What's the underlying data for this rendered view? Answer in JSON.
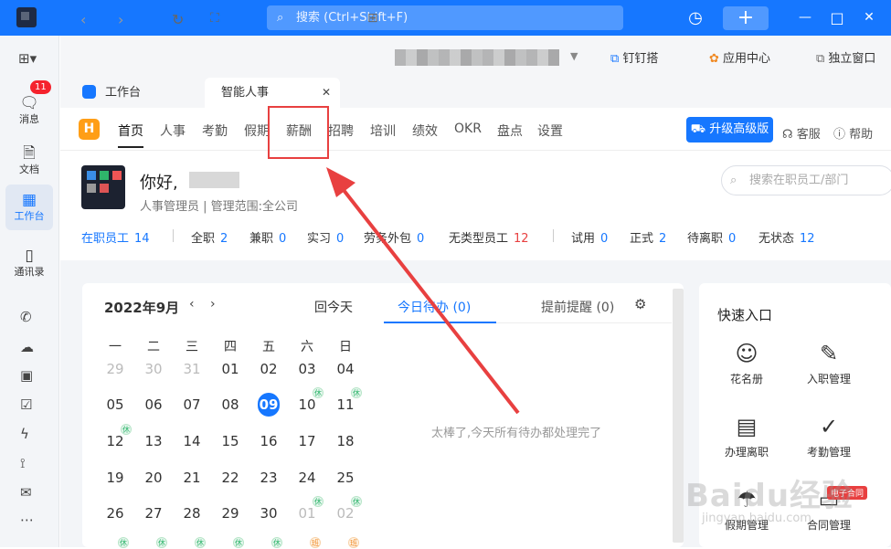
{
  "titlebar": {
    "search_placeholder": "搜索 (Ctrl+Shift+F)",
    "search_icon": "search-icon",
    "history_icon": "history-icon",
    "plus_label": "+",
    "min": "—",
    "max": "□",
    "close": "✕",
    "accent": "#1677ff"
  },
  "sidebar": {
    "items": [
      {
        "label": "消息",
        "icon": "message-icon",
        "badge": "11"
      },
      {
        "label": "文档",
        "icon": "doc-icon"
      },
      {
        "label": "工作台",
        "icon": "grid-icon"
      },
      {
        "label": "通讯录",
        "icon": "contacts-icon"
      }
    ]
  },
  "topbar": {
    "dingding": "钉钉搭",
    "app_center": "应用中心",
    "standalone": "独立窗口"
  },
  "tabs": [
    {
      "label": "工作台"
    },
    {
      "label": "智能人事",
      "close": "✕"
    }
  ],
  "hr": {
    "logo": "H",
    "menu": [
      "首页",
      "人事",
      "考勤",
      "假期",
      "薪酬",
      "招聘",
      "培训",
      "绩效",
      "OKR",
      "盘点",
      "设置"
    ],
    "upgrade": "升级高级版",
    "service": "客服",
    "help": "帮助"
  },
  "profile": {
    "hello": "你好,",
    "role": "人事管理员 | 管理范围:全公司",
    "search_placeholder": "搜索在职员工/部门"
  },
  "stats": [
    {
      "label": "在职员工",
      "value": "14",
      "blue_label": true
    },
    {
      "label": "全职",
      "value": "2"
    },
    {
      "label": "兼职",
      "value": "0"
    },
    {
      "label": "实习",
      "value": "0"
    },
    {
      "label": "劳务外包",
      "value": "0"
    },
    {
      "label": "无类型员工",
      "value": "12",
      "red": true
    },
    {
      "label": "试用",
      "value": "0"
    },
    {
      "label": "正式",
      "value": "2"
    },
    {
      "label": "待离职",
      "value": "0"
    },
    {
      "label": "无状态",
      "value": "12"
    }
  ],
  "calendar": {
    "title": "2022年9月",
    "prev": "‹",
    "next": "›",
    "today": "回今天",
    "todo": "今日待办 (0)",
    "remind": "提前提醒 (0)",
    "weekdays": [
      "一",
      "二",
      "三",
      "四",
      "五",
      "六",
      "日"
    ],
    "rows": [
      [
        "29",
        "30",
        "31",
        "01",
        "02",
        "03",
        "04"
      ],
      [
        "05",
        "06",
        "07",
        "08",
        "09",
        "10",
        "11"
      ],
      [
        "12",
        "13",
        "14",
        "15",
        "16",
        "17",
        "18"
      ],
      [
        "19",
        "20",
        "21",
        "22",
        "23",
        "24",
        "25"
      ],
      [
        "26",
        "27",
        "28",
        "29",
        "30",
        "01",
        "02"
      ]
    ],
    "rest_label": "休",
    "work_label": "班",
    "empty": "太棒了,今天所有待办都处理完了"
  },
  "quick": {
    "title": "快速入口",
    "items": [
      {
        "label": "花名册",
        "icon": "roster-icon"
      },
      {
        "label": "入职管理",
        "icon": "onboard-icon"
      },
      {
        "label": "办理离职",
        "icon": "offboard-icon"
      },
      {
        "label": "考勤管理",
        "icon": "attendance-icon"
      },
      {
        "label": "假期管理",
        "icon": "holiday-icon"
      },
      {
        "label": "合同管理",
        "icon": "contract-icon"
      }
    ],
    "contract_tag": "电子合同"
  },
  "watermark": {
    "main": "Baidu经验",
    "sub": "jingyan.baidu.com"
  }
}
